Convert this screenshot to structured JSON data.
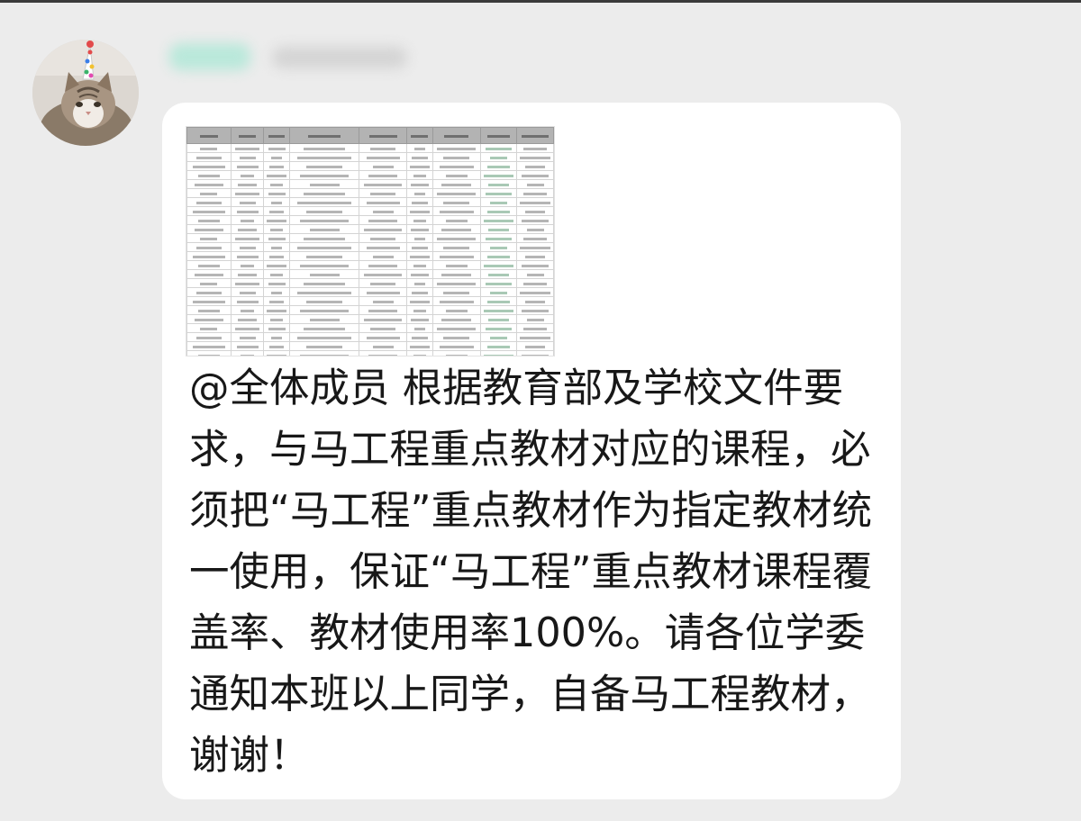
{
  "message": {
    "mention": "@全体成员",
    "text": " 根据教育部及学校文件要求，与马工程重点教材对应的课程，必须把“马工程”重点教材作为指定教材统一使用，保证“马工程”重点教材课程覆盖率、教材使用率100%。请各位学委通知本班以上同学，自备马工程教材，谢谢！"
  },
  "avatar": {
    "description": "cat-with-party-hat"
  },
  "colors": {
    "page_background": "#ececec",
    "bubble_background": "#ffffff",
    "sheet_header": "#b3b3b3"
  }
}
